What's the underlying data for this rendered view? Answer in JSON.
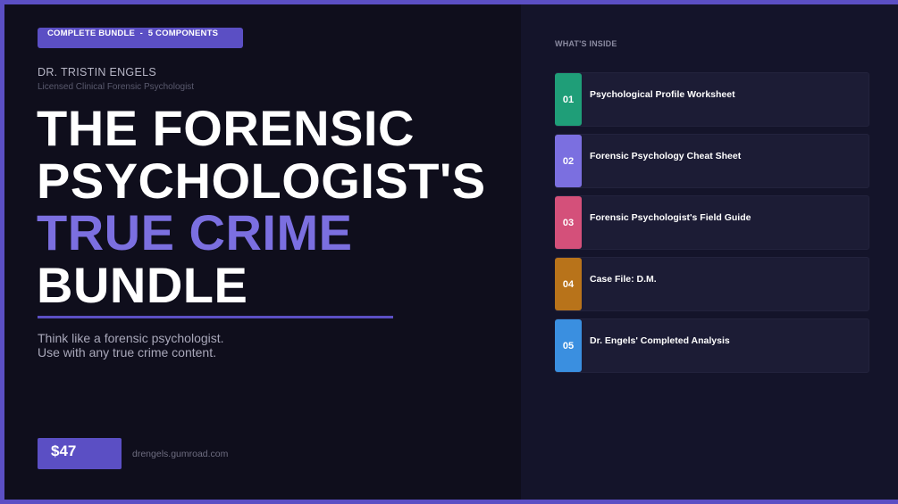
{
  "left_panel": {
    "badge": "COMPLETE BUNDLE  -  5 COMPONENTS",
    "author": {
      "name": "DR. TRISTIN ENGELS",
      "title": "Licensed Clinical Forensic Psychologist"
    },
    "headline": {
      "line1": "THE FORENSIC",
      "line2": "PSYCHOLOGIST'S",
      "line3": "TRUE CRIME",
      "line4": "BUNDLE"
    },
    "tagline": {
      "line1": "Think like a forensic psychologist.",
      "line2": "Use with any true crime content."
    },
    "price": "$47",
    "store_url": "drengels.gumroad.com"
  },
  "right_panel": {
    "heading": "WHAT'S INSIDE",
    "components": [
      {
        "number": "01",
        "title": "Psychological Profile Worksheet",
        "color": "#1f9e78"
      },
      {
        "number": "02",
        "title": "Forensic Psychology Cheat Sheet",
        "color": "#7b6fe0"
      },
      {
        "number": "03",
        "title": "Forensic Psychologist's Field Guide",
        "color": "#d4507a"
      },
      {
        "number": "04",
        "title": "Case File: D.M.",
        "color": "#b8731a"
      },
      {
        "number": "05",
        "title": "Dr. Engels' Completed Analysis",
        "color": "#3a8fe0"
      }
    ]
  },
  "colors": {
    "accent": "#5b4fc4",
    "accent_text": "#7b6fe0",
    "left_background": "#0f0e1c",
    "right_background": "#14142a"
  }
}
